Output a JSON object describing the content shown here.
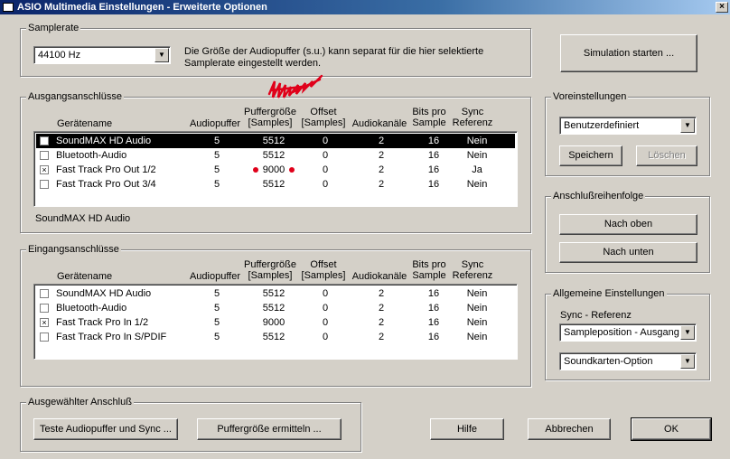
{
  "window": {
    "title": "ASIO Multimedia Einstellungen  - Erweiterte Optionen",
    "close_glyph": "×"
  },
  "samplerate": {
    "legend": "Samplerate",
    "value": "44100 Hz",
    "description": "Die Größe der Audiopuffer (s.u.) kann separat für die hier selektierte Samplerate eingestellt werden."
  },
  "simulation_button": "Simulation starten ...",
  "columns": {
    "device": "Gerätename",
    "buffers": "Audiopuffer",
    "buffer_size_1": "Puffergröße",
    "buffer_size_2": "[Samples]",
    "offset_1": "Offset",
    "offset_2": "[Samples]",
    "channels": "Audiokanäle",
    "bits_1": "Bits pro",
    "bits_2": "Sample",
    "sync_1": "Sync",
    "sync_2": "Referenz"
  },
  "outputs": {
    "legend": "Ausgangsanschlüsse",
    "rows": [
      {
        "check": "",
        "name": "SoundMAX HD Audio",
        "buffers": "5",
        "size": "5512",
        "offset": "0",
        "channels": "2",
        "bits": "16",
        "sync": "Nein"
      },
      {
        "check": "",
        "name": "Bluetooth-Audio",
        "buffers": "5",
        "size": "5512",
        "offset": "0",
        "channels": "2",
        "bits": "16",
        "sync": "Nein"
      },
      {
        "check": "×",
        "name": "Fast Track Pro Out 1/2",
        "buffers": "5",
        "size": "9000",
        "offset": "0",
        "channels": "2",
        "bits": "16",
        "sync": "Ja"
      },
      {
        "check": "",
        "name": "Fast Track Pro Out 3/4",
        "buffers": "5",
        "size": "5512",
        "offset": "0",
        "channels": "2",
        "bits": "16",
        "sync": "Nein"
      }
    ],
    "selected_label": "SoundMAX HD Audio"
  },
  "inputs": {
    "legend": "Eingangsanschlüsse",
    "rows": [
      {
        "check": "",
        "name": "SoundMAX HD Audio",
        "buffers": "5",
        "size": "5512",
        "offset": "0",
        "channels": "2",
        "bits": "16",
        "sync": "Nein"
      },
      {
        "check": "",
        "name": "Bluetooth-Audio",
        "buffers": "5",
        "size": "5512",
        "offset": "0",
        "channels": "2",
        "bits": "16",
        "sync": "Nein"
      },
      {
        "check": "×",
        "name": "Fast Track Pro In 1/2",
        "buffers": "5",
        "size": "9000",
        "offset": "0",
        "channels": "2",
        "bits": "16",
        "sync": "Nein"
      },
      {
        "check": "",
        "name": "Fast Track Pro In S/PDIF",
        "buffers": "5",
        "size": "5512",
        "offset": "0",
        "channels": "2",
        "bits": "16",
        "sync": "Nein"
      }
    ]
  },
  "presets": {
    "legend": "Voreinstellungen",
    "value": "Benutzerdefiniert",
    "save": "Speichern",
    "delete": "Löschen"
  },
  "order": {
    "legend": "Anschlußreihenfolge",
    "up": "Nach oben",
    "down": "Nach unten"
  },
  "general": {
    "legend": "Allgemeine Einstellungen",
    "sync_label": "Sync - Referenz",
    "sync_value": "Sampleposition - Ausgang",
    "card_value": "Soundkarten-Option"
  },
  "selected_port": {
    "legend": "Ausgewählter Anschluß",
    "test_button": "Teste Audiopuffer und Sync ...",
    "detect_button": "Puffergröße ermitteln ..."
  },
  "footer": {
    "help": "Hilfe",
    "cancel": "Abbrechen",
    "ok": "OK"
  },
  "icons": {
    "dropdown": "▼"
  },
  "colors": {
    "titlebar": "#0a246a",
    "face": "#d4d0c8",
    "annotation_red": "#e0001a"
  }
}
